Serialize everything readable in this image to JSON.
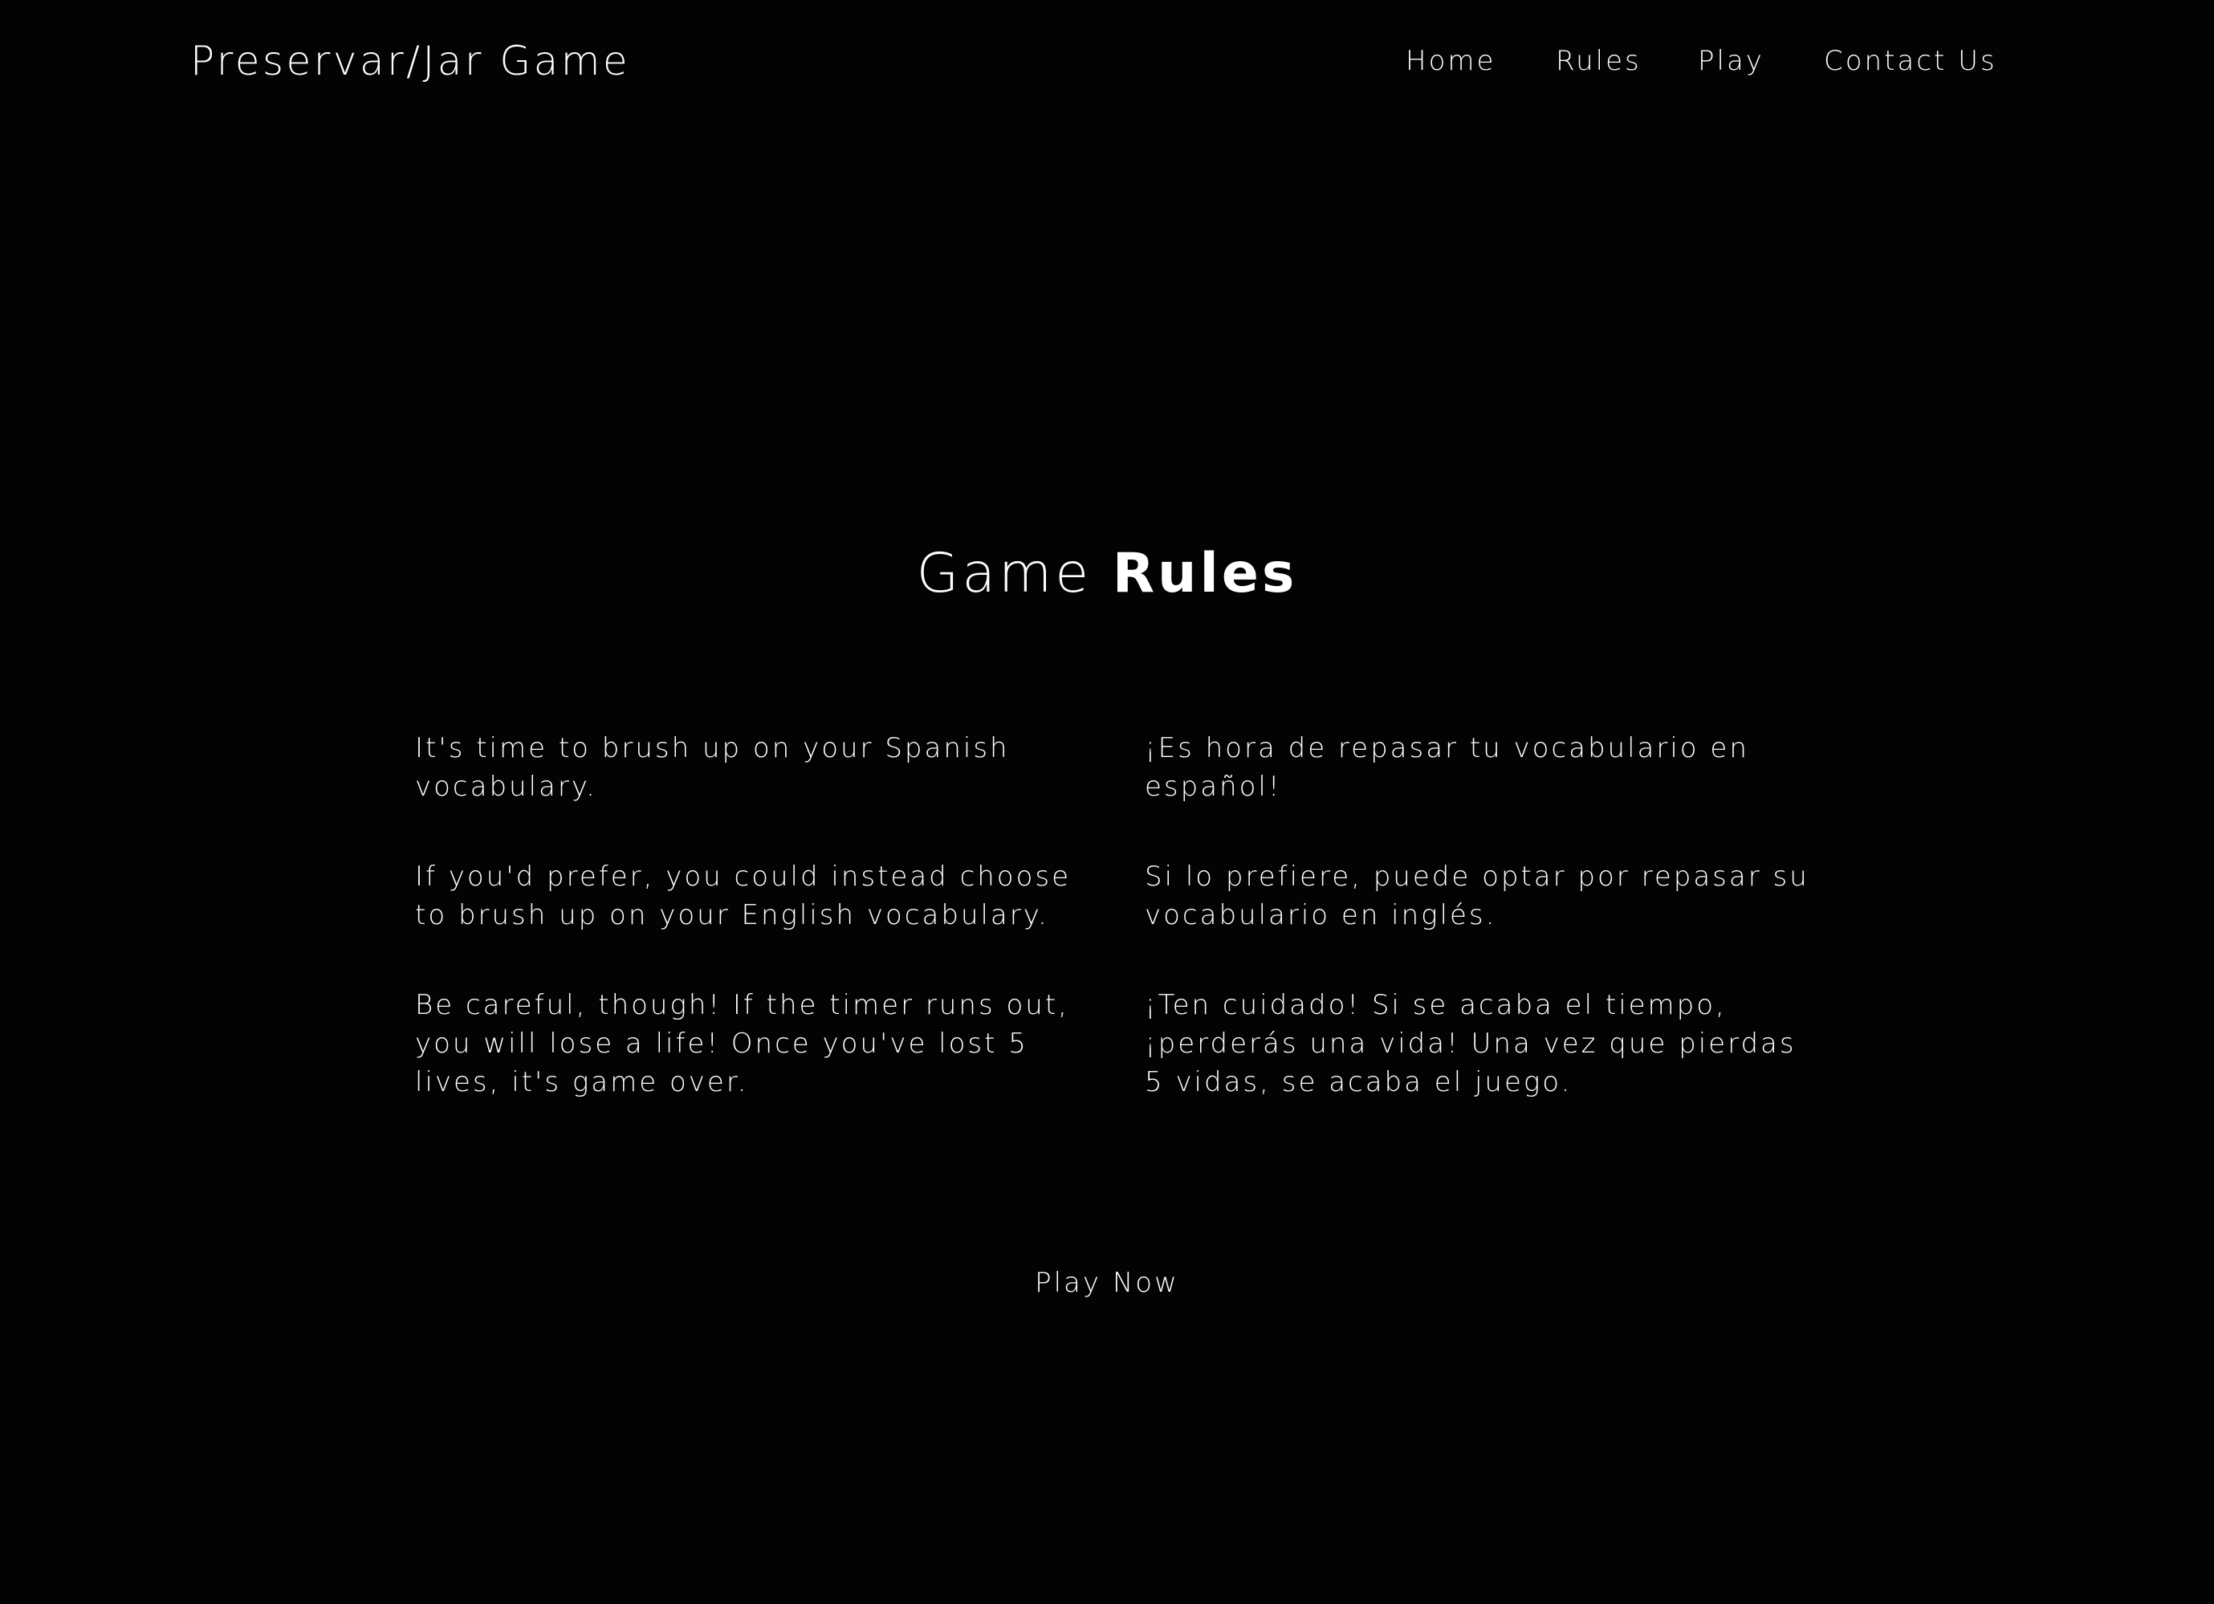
{
  "header": {
    "brand": "Preservar/Jar Game",
    "nav": {
      "home": "Home",
      "rules": "Rules",
      "play": "Play",
      "contact": "Contact Us"
    }
  },
  "main": {
    "title_light": "Game ",
    "title_bold": "Rules",
    "english": {
      "p1": "It's time to brush up on your Spanish vocabulary.",
      "p2": "If you'd prefer, you could instead choose to brush up on your English vocabulary.",
      "p3": "Be careful, though! If the timer runs out, you will lose a life! Once you've lost 5 lives, it's game over."
    },
    "spanish": {
      "p1": "¡Es hora de repasar tu vocabulario en español!",
      "p2": "Si lo prefiere, puede optar por repasar su vocabulario en inglés.",
      "p3": "¡Ten cuidado! Si se acaba el tiempo, ¡perderás una vida! Una vez que pierdas 5 vidas, se acaba el juego."
    },
    "cta": "Play Now"
  },
  "colors": {
    "background": "#030303",
    "text": "#ffffff"
  }
}
